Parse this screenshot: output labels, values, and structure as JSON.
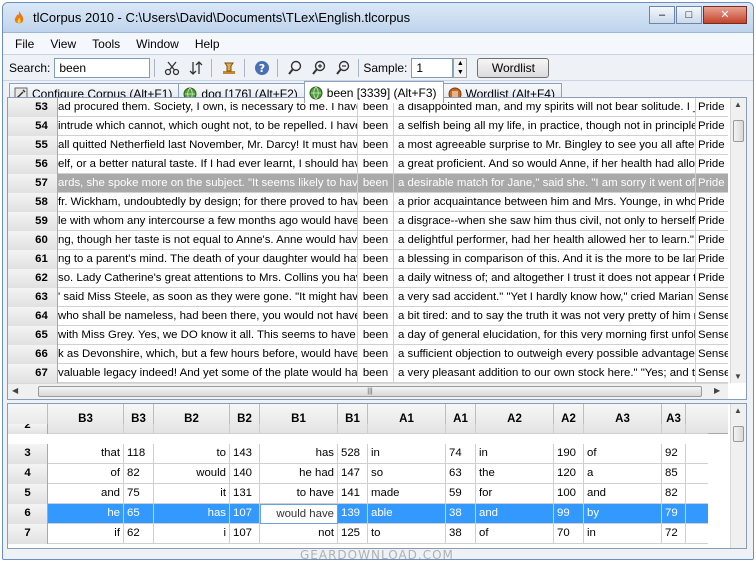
{
  "window": {
    "title": "tlCorpus 2010 - C:\\Users\\David\\Documents\\TLex\\English.tlcorpus",
    "minimize_glyph": "–",
    "maximize_glyph": "□",
    "close_glyph": "✕"
  },
  "menu": [
    "File",
    "View",
    "Tools",
    "Window",
    "Help"
  ],
  "toolbar": {
    "search_label": "Search:",
    "search_value": "been",
    "sample_label": "Sample:",
    "sample_value": "1",
    "wordlist_label": "Wordlist",
    "icons": [
      "scissors-icon",
      "sort-icon",
      "stamp-icon",
      "help-icon",
      "zoom-icon",
      "zoom-in-icon",
      "zoom-out-icon"
    ]
  },
  "tabs": [
    {
      "label": "Configure Corpus (Alt+F1)",
      "active": false,
      "icon": "configure-icon"
    },
    {
      "label": "dog [176] (Alt+F2)",
      "active": false,
      "icon": "globe-icon"
    },
    {
      "label": "been [3339] (Alt+F3)",
      "active": true,
      "icon": "globe-icon"
    },
    {
      "label": "Wordlist (Alt+F4)",
      "active": false,
      "icon": "wordlist-icon"
    }
  ],
  "concordance": {
    "rows": [
      {
        "num": "53",
        "left": "ad procured them.  Society, I own, is necessary to me.  I have",
        "key": "been",
        "right": "a disappointed man, and my spirits will not bear solitude.  I _m",
        "src": "Pride",
        "selected": false
      },
      {
        "num": "54",
        "left": "intrude which cannot, which ought not, to be repelled.  I have",
        "key": "been",
        "right": "a selfish being all my life, in practice, though not in principle.  a",
        "src": "Pride",
        "selected": false
      },
      {
        "num": "55",
        "left": "all quitted Netherfield last November, Mr. Darcy!  It must have",
        "key": "been",
        "right": "a most agreeable surprise to Mr. Bingley to see you all after h",
        "src": "Pride",
        "selected": false
      },
      {
        "num": "56",
        "left": "elf, or a better natural taste.  If I had ever learnt, I should have",
        "key": "been",
        "right": "a great proficient.  And so would Anne, if her health had allow",
        "src": "Pride",
        "selected": false
      },
      {
        "num": "57",
        "left": "ards, she spoke more on the subject.  \"It seems likely to have",
        "key": "been",
        "right": "a desirable match for Jane,\" said she.  \"I am sorry it went off.",
        "src": "Pride",
        "selected": true
      },
      {
        "num": "58",
        "left": "fr. Wickham, undoubtedly by design; for there proved to have",
        "key": "been",
        "right": "a prior acquaintance between him and Mrs. Younge, in whos",
        "src": "Pride",
        "selected": false
      },
      {
        "num": "59",
        "left": "le with whom any intercourse a few months ago would have",
        "key": "been",
        "right": "a disgrace--when she saw him thus civil, not only to herself,",
        "src": "Pride",
        "selected": false
      },
      {
        "num": "60",
        "left": "ng, though her taste is not equal to Anne's.  Anne would have",
        "key": "been",
        "right": "a delightful performer, had her health allowed her to learn.\"  E",
        "src": "Pride",
        "selected": false
      },
      {
        "num": "61",
        "left": "ng to a parent's mind. The death of your daughter would have",
        "key": "been",
        "right": "a blessing in comparison of this.  And it is the more to be lame",
        "src": "Pride",
        "selected": false
      },
      {
        "num": "62",
        "left": "so.  Lady Catherine's great attentions to Mrs. Collins you have",
        "key": "been",
        "right": "a daily witness of; and altogether I trust it does not appear th",
        "src": "Pride",
        "selected": false
      },
      {
        "num": "63",
        "left": "' said Miss Steele, as soon as they were gone.  \"It might have",
        "key": "been",
        "right": "a very sad accident.\"  \"Yet I hardly know how,\" cried Marian",
        "src": "Sense",
        "selected": false
      },
      {
        "num": "64",
        "left": "who shall be nameless, had been there, you would not have",
        "key": "been",
        "right": "a bit tired: and to say the truth it was not very pretty of him n",
        "src": "Sense",
        "selected": false
      },
      {
        "num": "65",
        "left": "with Miss Grey.  Yes, we DO know it all.  This seems to have",
        "key": "been",
        "right": "a day of general elucidation, for this very morning first unfold",
        "src": "Sense",
        "selected": false
      },
      {
        "num": "66",
        "left": "k as Devonshire, which, but a few hours before, would have",
        "key": "been",
        "right": "a sufficient objection to outweigh every possible advantage b",
        "src": "Sense",
        "selected": false
      },
      {
        "num": "67",
        "left": "valuable legacy indeed! And yet some of the plate would have",
        "key": "been",
        "right": "a very pleasant addition to our own stock here.\"  \"Yes; and th",
        "src": "Sense",
        "selected": false
      }
    ],
    "hscroll_glyph": "|||"
  },
  "collocates": {
    "headers": [
      "",
      "B3",
      "B3",
      "B2",
      "B2",
      "B1",
      "B1",
      "A1",
      "A1",
      "A2",
      "A2",
      "A3",
      "A3"
    ],
    "rows": [
      {
        "num": "2",
        "b3w": "",
        "b3n": "",
        "b2w": "",
        "b2n": "",
        "b1w": "",
        "b1n": "",
        "a1w": "",
        "a1n": "",
        "a2w": "",
        "a2n": "",
        "a3w": "",
        "a3n": "",
        "selected": false,
        "partial": true
      },
      {
        "num": "3",
        "b3w": "that",
        "b3n": "118",
        "b2w": "to",
        "b2n": "143",
        "b1w": "has",
        "b1n": "528",
        "a1w": "in",
        "a1n": "74",
        "a2w": "in",
        "a2n": "190",
        "a3w": "of",
        "a3n": "92",
        "selected": false
      },
      {
        "num": "4",
        "b3w": "of",
        "b3n": "82",
        "b2w": "would",
        "b2n": "140",
        "b1w": "he had",
        "b1n": "147",
        "a1w": "so",
        "a1n": "63",
        "a2w": "the",
        "a2n": "120",
        "a3w": "a",
        "a3n": "85",
        "selected": false
      },
      {
        "num": "5",
        "b3w": "and",
        "b3n": "75",
        "b2w": "it",
        "b2n": "131",
        "b1w": "to have",
        "b1n": "141",
        "a1w": "made",
        "a1n": "59",
        "a2w": "for",
        "a2n": "100",
        "a3w": "and",
        "a3n": "82",
        "selected": false
      },
      {
        "num": "6",
        "b3w": "he",
        "b3n": "65",
        "b2w": "has",
        "b2n": "107",
        "b1w": "would have",
        "b1n": "139",
        "a1w": "able",
        "a1n": "38",
        "a2w": "and",
        "a2n": "99",
        "a3w": "by",
        "a3n": "79",
        "selected": true
      },
      {
        "num": "7",
        "b3w": "if",
        "b3n": "62",
        "b2w": "i",
        "b2n": "107",
        "b1w": "not",
        "b1n": "125",
        "a1w": "to",
        "a1n": "38",
        "a2w": "of",
        "a2n": "70",
        "a3w": "in",
        "a3n": "72",
        "selected": false
      }
    ]
  },
  "watermark": "GEARDOWNLOAD.COM",
  "colors": {
    "selection_blue": "#3399ff",
    "selection_gray": "#a9a9a9",
    "title_gradient_top": "#dce9f7",
    "title_gradient_bottom": "#bfd4ec"
  }
}
